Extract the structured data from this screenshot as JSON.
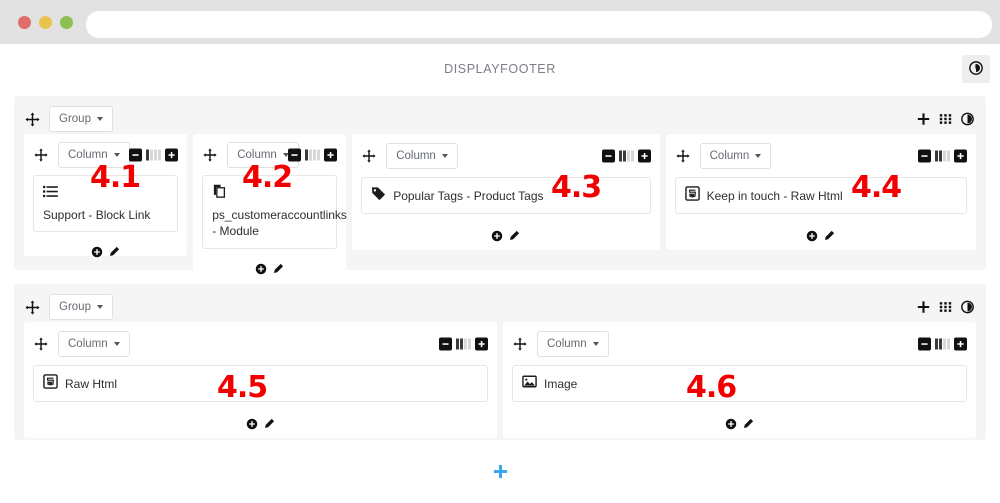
{
  "browser": {
    "url_value": "",
    "url_placeholder": "",
    "traffic_lights": [
      "close",
      "minimize",
      "maximize"
    ]
  },
  "header": {
    "title": "DISPLAYFOOTER",
    "action_icon": "history-clock-icon"
  },
  "labels": {
    "group": "Group",
    "column": "Column"
  },
  "icons": {
    "move": "move-arrows-icon",
    "add": "plus-icon",
    "grid": "grid-dots-icon",
    "history": "history-clock-icon",
    "minus": "minus-icon",
    "plus_square": "plus-square-icon",
    "width_meter": "column-width-meter-icon",
    "add_widget": "add-circle-icon",
    "edit": "pencil-edit-icon",
    "add_group": "add-group-plus-icon"
  },
  "groups": [
    {
      "name": "group-1",
      "label": "Group",
      "tools": [
        "plus-icon",
        "grid-dots-icon",
        "history-clock-icon"
      ],
      "columns": [
        {
          "name": "column-1",
          "label": "Column",
          "annotation": "4.1",
          "width_filled": 1,
          "width_total": 4,
          "layout": "stacked",
          "widget": {
            "icon": "list-bullets-icon",
            "label": "Support - Block Link"
          }
        },
        {
          "name": "column-2",
          "label": "Column",
          "annotation": "4.2",
          "width_filled": 1,
          "width_total": 4,
          "layout": "stacked",
          "widget": {
            "icon": "copy-clone-icon",
            "label": "ps_customeraccountlinks - Module"
          }
        },
        {
          "name": "column-3",
          "label": "Column",
          "annotation": "4.3",
          "width_filled": 2,
          "width_total": 4,
          "layout": "inline",
          "widget": {
            "icon": "tag-icon",
            "label": "Popular Tags - Product Tags"
          }
        },
        {
          "name": "column-4",
          "label": "Column",
          "annotation": "4.4",
          "width_filled": 2,
          "width_total": 4,
          "layout": "inline",
          "widget": {
            "icon": "html5-icon",
            "label": "Keep in touch - Raw Html"
          }
        }
      ]
    },
    {
      "name": "group-2",
      "label": "Group",
      "tools": [
        "plus-icon",
        "grid-dots-icon",
        "history-clock-icon"
      ],
      "columns": [
        {
          "name": "column-5",
          "label": "Column",
          "annotation": "4.5",
          "width_filled": 2,
          "width_total": 4,
          "layout": "inline",
          "widget": {
            "icon": "html5-icon",
            "label": "Raw Html"
          }
        },
        {
          "name": "column-6",
          "label": "Column",
          "annotation": "4.6",
          "width_filled": 2,
          "width_total": 4,
          "layout": "inline",
          "widget": {
            "icon": "image-icon",
            "label": "Image"
          }
        }
      ]
    }
  ],
  "footer": {
    "add_label": "+"
  },
  "colors": {
    "annotation": "#f20000",
    "add_accent": "#39a6f0",
    "chrome": "#e2e2e2",
    "group_bg": "#f5f5f5"
  }
}
